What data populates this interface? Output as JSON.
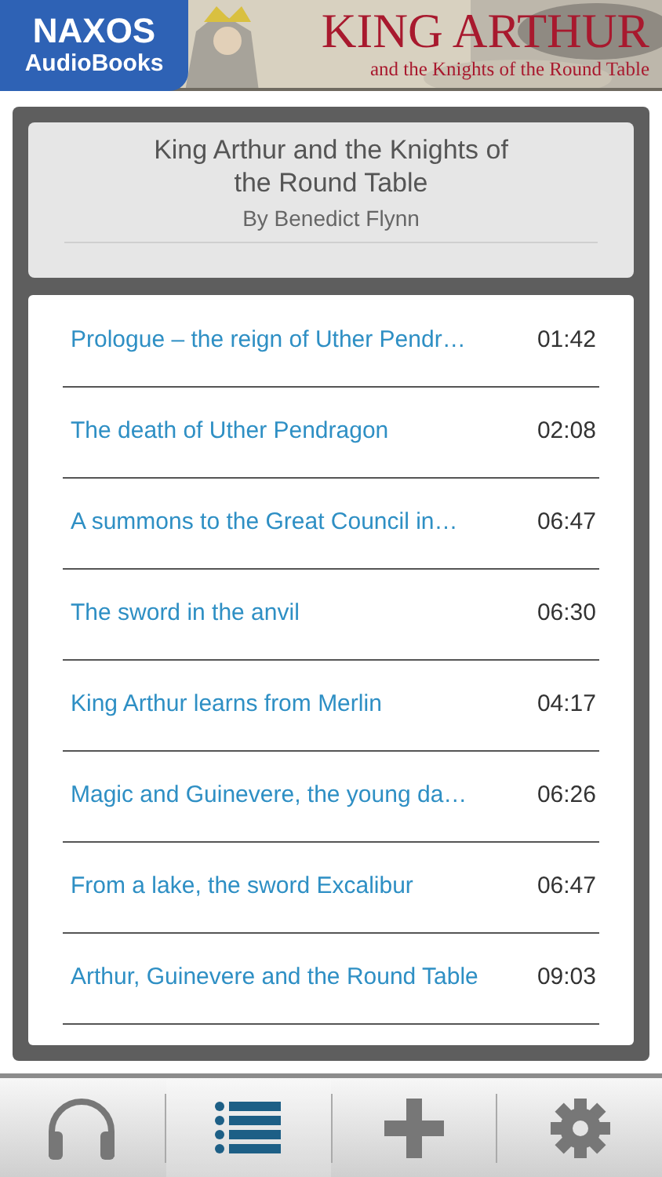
{
  "banner": {
    "logo_line_1": "NAXOS",
    "logo_line_2": "AudioBooks",
    "title": "KING ARTHUR",
    "subtitle": "and the Knights of the Round Table"
  },
  "book": {
    "title": "King Arthur and the Knights of the Round Table",
    "author": "By Benedict Flynn"
  },
  "tracks": [
    {
      "title": "Prologue – the reign of Uther Pendr…",
      "duration": "01:42"
    },
    {
      "title": "The death of Uther Pendragon",
      "duration": "02:08"
    },
    {
      "title": "A summons to the Great Council in…",
      "duration": "06:47"
    },
    {
      "title": "The sword in the anvil",
      "duration": "06:30"
    },
    {
      "title": "King Arthur learns from Merlin",
      "duration": "04:17"
    },
    {
      "title": "Magic and Guinevere, the young da…",
      "duration": "06:26"
    },
    {
      "title": "From a lake, the sword Excalibur",
      "duration": "06:47"
    },
    {
      "title": "Arthur, Guinevere and the Round Table",
      "duration": "09:03"
    }
  ],
  "tab_bar": [
    {
      "kind": "player",
      "selected": false
    },
    {
      "kind": "list",
      "selected": true
    },
    {
      "kind": "add",
      "selected": false
    },
    {
      "kind": "settings",
      "selected": false
    }
  ]
}
